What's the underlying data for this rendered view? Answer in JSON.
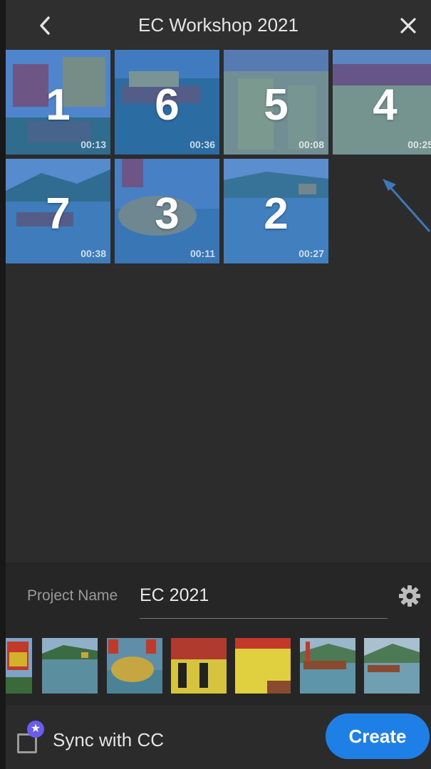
{
  "header": {
    "title": "EC Workshop 2021",
    "back_icon": "chevron-left-icon",
    "close_icon": "close-icon"
  },
  "clips": [
    {
      "order": "1",
      "duration": "00:13"
    },
    {
      "order": "6",
      "duration": "00:36"
    },
    {
      "order": "5",
      "duration": "00:08"
    },
    {
      "order": "4",
      "duration": "00:25"
    },
    {
      "order": "7",
      "duration": "00:38"
    },
    {
      "order": "3",
      "duration": "00:11"
    },
    {
      "order": "2",
      "duration": "00:27"
    }
  ],
  "project": {
    "label": "Project Name",
    "value": "EC 2021",
    "settings_icon": "gear-icon"
  },
  "footer": {
    "sync_label": "Sync with CC",
    "create_label": "Create"
  },
  "colors": {
    "accent": "#1e7fe6",
    "selection_tint": "#286ed2",
    "sync_badge": "#6a5cf0",
    "annotation_arrow": "#3f78b8"
  }
}
